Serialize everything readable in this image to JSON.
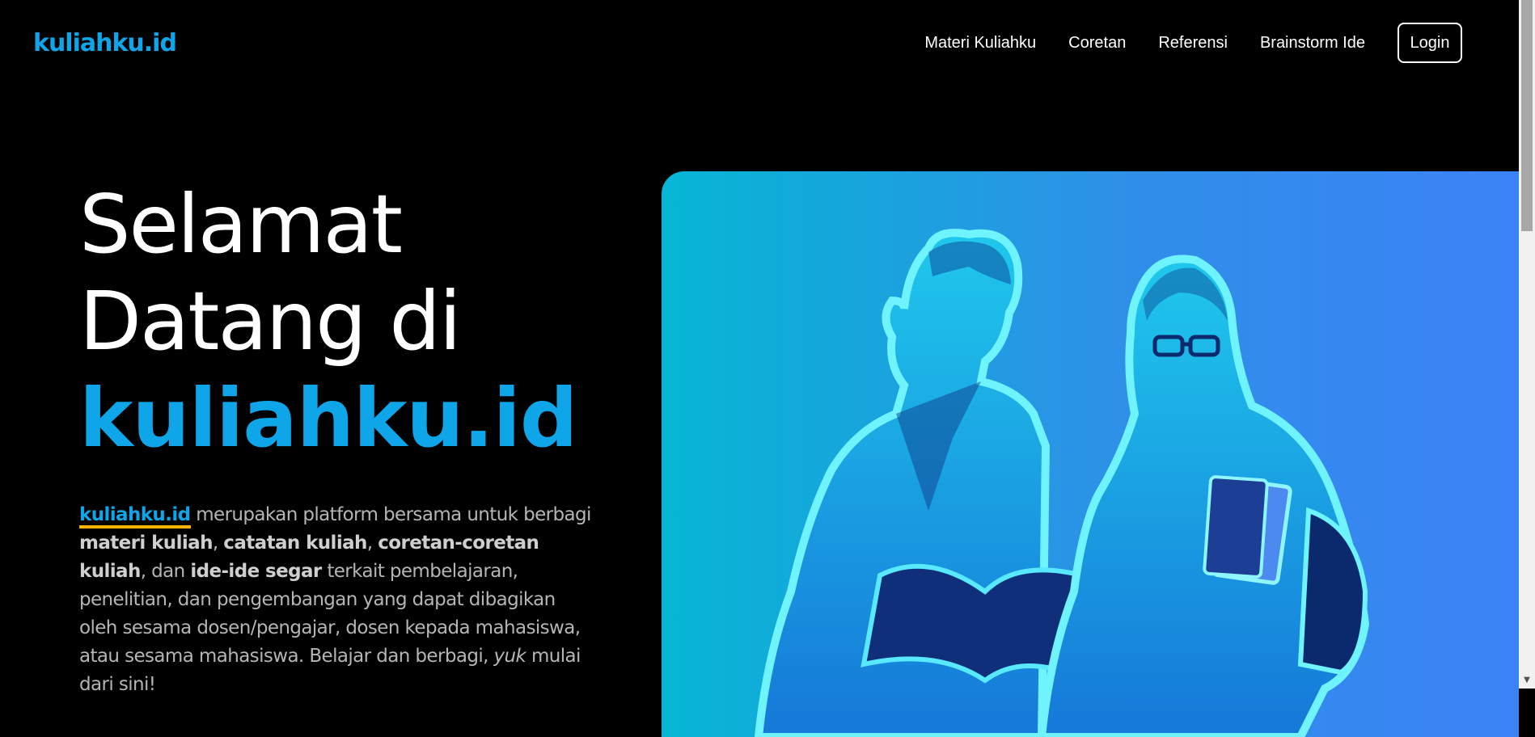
{
  "header": {
    "logo": "kuliahku.id",
    "nav": [
      "Materi Kuliahku",
      "Coretan",
      "Referensi",
      "Brainstorm Ide"
    ],
    "login_label": "Login"
  },
  "hero": {
    "title_line1": "Selamat",
    "title_line2": "Datang di",
    "title_brand": "kuliahku.id",
    "desc": {
      "brand_link": "kuliahku.id",
      "t1": " merupakan platform bersama untuk berbagi ",
      "b1": "materi kuliah",
      "t2": ", ",
      "b2": "catatan kuliah",
      "t3": ", ",
      "b3": "coretan-coretan kuliah",
      "t4": ", dan ",
      "b4": "ide-ide segar",
      "t5": " terkait pembelajaran, penelitian, dan pengembangan yang dapat dibagikan oleh sesama dosen/pengajar, dosen kepada mahasiswa, atau sesama mahasiswa. Belajar dan berbagi, ",
      "i1": "yuk",
      "t6": " mulai dari sini!"
    }
  },
  "colors": {
    "brand": "#0ea5e9",
    "underline": "#f5b400",
    "panel_gradient_start": "#06b6d4",
    "panel_gradient_end": "#3b82f6"
  },
  "icons": {
    "scroll_down": "chevron-down-icon"
  }
}
